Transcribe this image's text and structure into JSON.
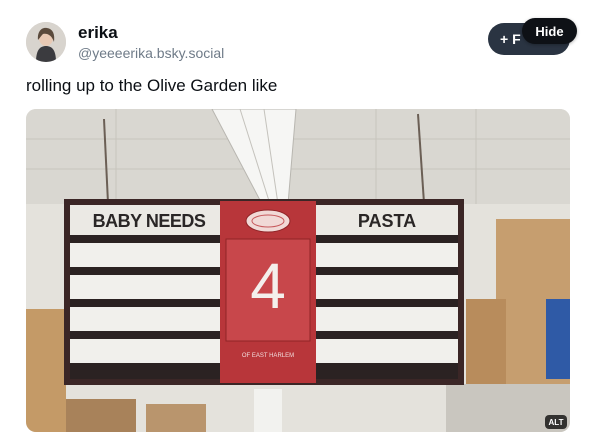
{
  "author": {
    "display_name": "erika",
    "handle": "@yeeeerika.bsky.social"
  },
  "follow_button": {
    "label": "+ F"
  },
  "tooltip": {
    "label": "Hide"
  },
  "post": {
    "text": "rolling up to the Olive Garden like"
  },
  "image": {
    "alt_badge": "ALT",
    "sign": {
      "left_aisle": "BABY NEEDS",
      "right_aisle": "PASTA",
      "aisle_number": "4",
      "store_tagline": "OF EAST HARLEM"
    }
  },
  "colors": {
    "button_bg": "#2a3442",
    "sign_red": "#b8363a",
    "text_primary": "#0b0f14",
    "text_secondary": "#6f7b88"
  }
}
